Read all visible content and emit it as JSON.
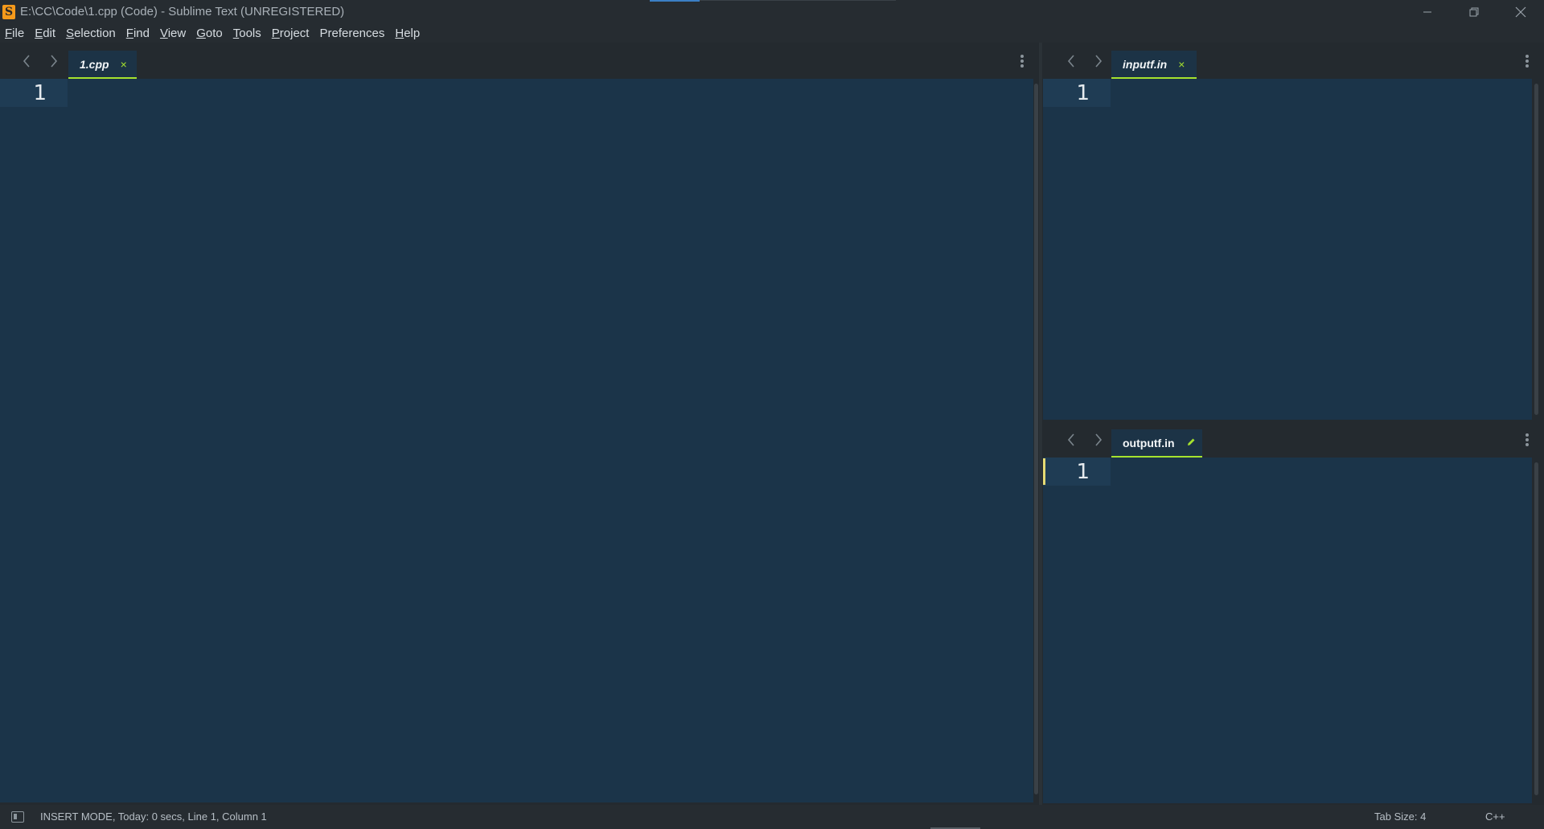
{
  "window": {
    "title": "E:\\CC\\Code\\1.cpp (Code) - Sublime Text (UNREGISTERED)",
    "logo_letter": "S"
  },
  "menu": [
    {
      "label": "File",
      "key": "F",
      "rest": "ile"
    },
    {
      "label": "Edit",
      "key": "E",
      "rest": "dit"
    },
    {
      "label": "Selection",
      "key": "S",
      "rest": "election"
    },
    {
      "label": "Find",
      "key": "F",
      "rest": "ind"
    },
    {
      "label": "View",
      "key": "V",
      "rest": "iew"
    },
    {
      "label": "Goto",
      "key": "G",
      "rest": "oto"
    },
    {
      "label": "Tools",
      "key": "T",
      "rest": "ools"
    },
    {
      "label": "Project",
      "key": "P",
      "rest": "roject"
    },
    {
      "label": "Preferences",
      "key": "",
      "rest": "Preferences"
    },
    {
      "label": "Help",
      "key": "H",
      "rest": "elp"
    }
  ],
  "panes": {
    "left": {
      "tab_label": "1.cpp",
      "tab_icon": "close-icon",
      "close_glyph": "×",
      "line_number": "1"
    },
    "top_right": {
      "tab_label": "inputf.in",
      "tab_icon": "close-icon",
      "close_glyph": "×",
      "line_number": "1"
    },
    "bottom_right": {
      "tab_label": "outputf.in",
      "tab_icon": "pencil-icon",
      "line_number": "1"
    }
  },
  "status": {
    "text": "INSERT MODE, Today: 0 secs, Line 1, Column 1",
    "tab_size": "Tab Size: 4",
    "syntax": "C++"
  },
  "colors": {
    "editor_bg": "#1b3449",
    "accent": "#a6e22e",
    "caret": "#e6db74"
  }
}
